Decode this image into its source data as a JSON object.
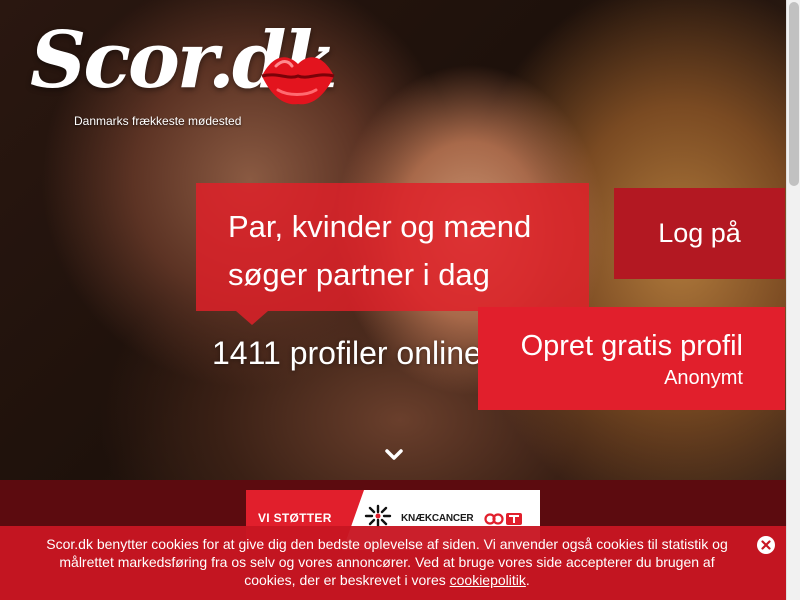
{
  "brand": {
    "logo_text": "Scor.dk",
    "tagline": "Danmarks frækkeste mødested",
    "logo_icon": "lips-icon",
    "accent_color": "#e11f2c",
    "dark_accent_color": "#b31822"
  },
  "hero": {
    "headline_line1": "Par, kvinder og mænd",
    "headline_line2": "søger partner i dag",
    "online_text": "1411 profiler online"
  },
  "actions": {
    "login_label": "Log på",
    "signup_label": "Opret gratis profil",
    "signup_sublabel": "Anonymt",
    "scroll_icon": "chevron-down-icon"
  },
  "support": {
    "label": "VI STØTTER",
    "partner_name": "KNÆKCANCER",
    "partner_logo_icon": "knaek-cancer-icon",
    "broadcaster_icon": "tv2-icon"
  },
  "cookie": {
    "text": "Scor.dk benytter cookies for at give dig den bedste oplevelse af siden. Vi anvender også cookies til statistik og målrettet markedsføring fra os selv og vores annoncører. Ved at bruge vores side accepterer du brugen af cookies, der er beskrevet i vores ",
    "link_text": "cookiepolitik",
    "suffix": ".",
    "close_icon": "close-icon"
  }
}
